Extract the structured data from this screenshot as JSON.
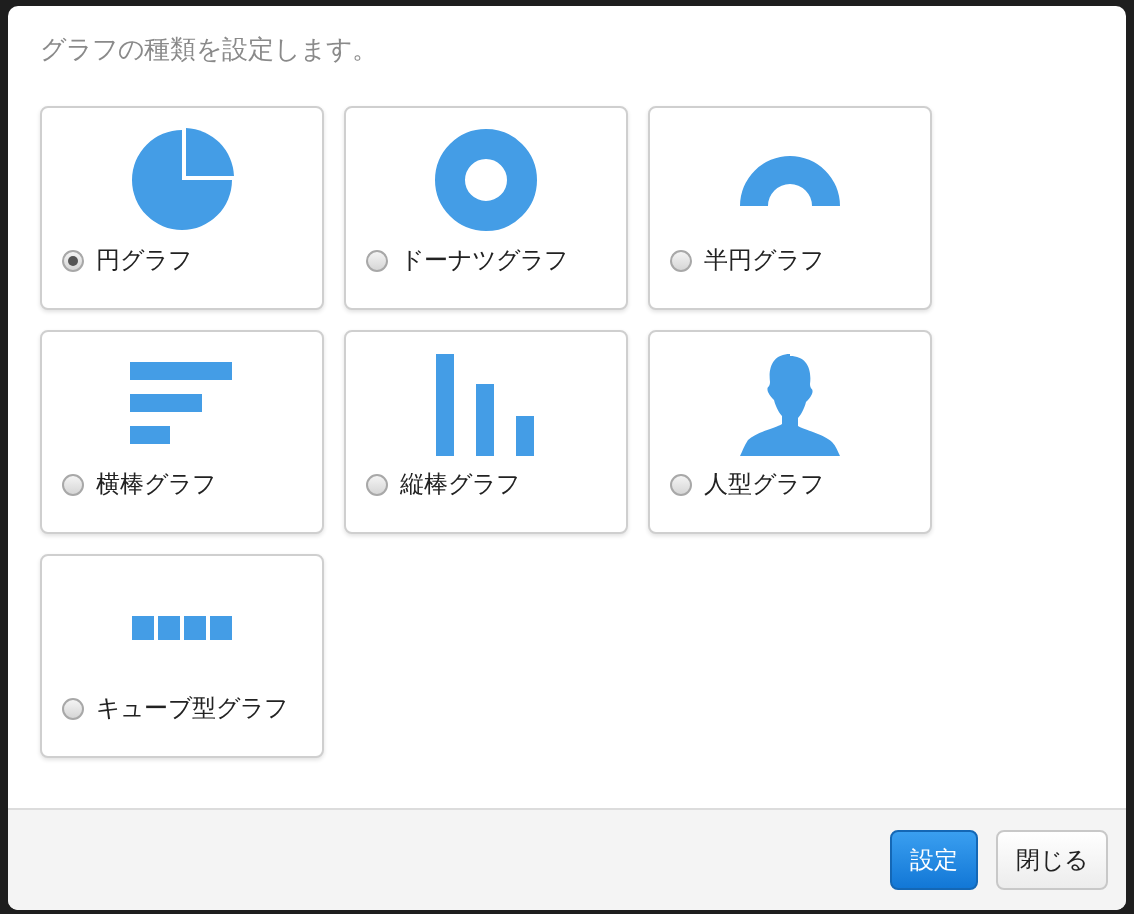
{
  "dialog": {
    "message": "グラフの種類を設定します。",
    "options": [
      {
        "kind": "pie",
        "label": "円グラフ",
        "selected": true
      },
      {
        "kind": "donut",
        "label": "ドーナツグラフ",
        "selected": false
      },
      {
        "kind": "half",
        "label": "半円グラフ",
        "selected": false
      },
      {
        "kind": "hbar",
        "label": "横棒グラフ",
        "selected": false
      },
      {
        "kind": "vbar",
        "label": "縦棒グラフ",
        "selected": false
      },
      {
        "kind": "person",
        "label": "人型グラフ",
        "selected": false
      },
      {
        "kind": "cube",
        "label": "キューブ型グラフ",
        "selected": false
      }
    ],
    "buttons": [
      {
        "kind": "primary",
        "label": "設定"
      },
      {
        "kind": "default",
        "label": "閉じる"
      }
    ]
  }
}
